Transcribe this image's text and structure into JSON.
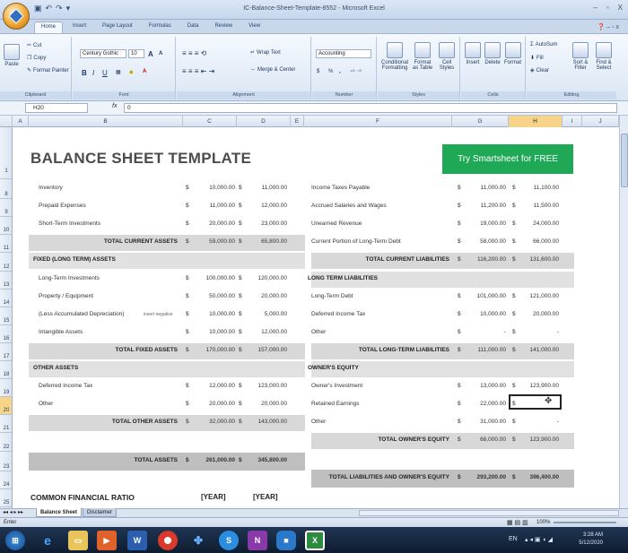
{
  "window": {
    "title": "IC-Balance-Sheet-Template-8552 - Microsoft Excel",
    "min": "–",
    "max": "▫",
    "close": "X"
  },
  "qat": {
    "save": "▣",
    "undo": "↶",
    "redo": "↷",
    "more": "▾"
  },
  "tabs": [
    "Home",
    "Insert",
    "Page Layout",
    "Formulas",
    "Data",
    "Review",
    "View"
  ],
  "ribbon": {
    "clipboard": {
      "paste": "Paste",
      "cut": "Cut",
      "copy": "Copy",
      "painter": "Format Painter",
      "label": "Clipboard"
    },
    "font": {
      "name": "Century Gothic",
      "size": "10",
      "grow": "A",
      "shrink": "A",
      "bold": "B",
      "italic": "I",
      "underline": "U",
      "label": "Font"
    },
    "alignment": {
      "wrap": "Wrap Text",
      "merge": "Merge & Center",
      "label": "Alignment"
    },
    "number": {
      "format": "Accounting",
      "currency": "$",
      "percent": "%",
      "comma": ",",
      "label": "Number"
    },
    "styles": {
      "conditional": "Conditional Formatting",
      "table": "Format as Table",
      "cell": "Cell Styles",
      "label": "Styles"
    },
    "cells": {
      "insert": "Insert",
      "delete": "Delete",
      "format": "Format",
      "label": "Cells"
    },
    "editing": {
      "autosum": "AutoSum",
      "fill": "Fill",
      "clear": "Clear",
      "sort": "Sort & Filter",
      "find": "Find & Select",
      "label": "Editing"
    }
  },
  "formula": {
    "name_box": "H20",
    "fx": "fx",
    "content": "0"
  },
  "columns": [
    "A",
    "B",
    "C",
    "D",
    "E",
    "F",
    "G",
    "H",
    "I",
    "J"
  ],
  "rows": [
    "1",
    "8",
    "9",
    "10",
    "11",
    "12",
    "13",
    "14",
    "15",
    "16",
    "17",
    "18",
    "19",
    "20",
    "21",
    "22",
    "23",
    "24",
    "25"
  ],
  "sheet": {
    "title": "BALANCE SHEET TEMPLATE",
    "cta": "Try Smartsheet for FREE",
    "left": [
      {
        "label": "Inventory",
        "c": "10,000.00",
        "d": "11,000.00"
      },
      {
        "label": "Prepaid Expenses",
        "c": "11,000.00",
        "d": "12,000.00"
      },
      {
        "label": "Short-Term Investments",
        "c": "20,000.00",
        "d": "23,000.00"
      },
      {
        "label": "TOTAL CURRENT ASSETS",
        "c": "59,000.00",
        "d": "65,800.00",
        "total": true
      },
      {
        "label": "FIXED (LONG TERM) ASSETS",
        "section": true
      },
      {
        "label": "Long-Term Investments",
        "c": "100,000.00",
        "d": "120,000.00"
      },
      {
        "label": "Property / Equipment",
        "c": "50,000.00",
        "d": "20,000.00"
      },
      {
        "label": "(Less Accumulated Depreciation)",
        "note": "insert negative",
        "c": "10,000.00",
        "d": "5,000.00"
      },
      {
        "label": "Intangible Assets",
        "c": "10,000.00",
        "d": "12,000.00"
      },
      {
        "label": "TOTAL FIXED ASSETS",
        "c": "170,000.00",
        "d": "157,000.00",
        "total": true
      },
      {
        "label": "OTHER ASSETS",
        "section": true
      },
      {
        "label": "Deferred Income Tax",
        "c": "12,000.00",
        "d": "123,000.00"
      },
      {
        "label": "Other",
        "c": "20,000.00",
        "d": "20,000.00"
      },
      {
        "label": "TOTAL OTHER ASSETS",
        "c": "32,000.00",
        "d": "143,000.00",
        "total": true
      }
    ],
    "right": [
      {
        "label": "Income Taxes Payable",
        "g": "11,000.00",
        "h": "11,100.00"
      },
      {
        "label": "Accrued Salaries and Wages",
        "g": "11,200.00",
        "h": "11,500.00"
      },
      {
        "label": "Unearned Revenue",
        "g": "19,000.00",
        "h": "24,000.00"
      },
      {
        "label": "Current Portion of Long-Term Debt",
        "g": "58,000.00",
        "h": "66,000.00"
      },
      {
        "label": "TOTAL CURRENT LIABILITIES",
        "g": "116,200.00",
        "h": "131,600.00",
        "total": true
      },
      {
        "label": "LONG TERM LIABILITIES",
        "section": true
      },
      {
        "label": "Long-Term Debt",
        "g": "101,000.00",
        "h": "121,000.00"
      },
      {
        "label": "Deferred Income Tax",
        "g": "10,000.00",
        "h": "20,000.00"
      },
      {
        "label": "Other",
        "g": "-",
        "h": "-"
      },
      {
        "label": "TOTAL LONG-TERM LIABILITIES",
        "g": "111,000.00",
        "h": "141,000.00",
        "total": true
      },
      {
        "label": "OWNER'S EQUITY",
        "section": true
      },
      {
        "label": "Owner's Investment",
        "g": "13,000.00",
        "h": "123,900.00"
      },
      {
        "label": "Retained Earnings",
        "g": "22,000.00",
        "h": ""
      },
      {
        "label": "Other",
        "g": "31,000.00",
        "h": "-"
      },
      {
        "label": "TOTAL OWNER'S EQUITY",
        "g": "66,000.00",
        "h": "123,900.00",
        "total": true
      }
    ],
    "total_assets": {
      "label": "TOTAL ASSETS",
      "c": "261,000.00",
      "d": "345,800.00"
    },
    "total_liab": {
      "label": "TOTAL LIABILITIES AND OWNER'S EQUITY",
      "g": "293,200.00",
      "h": "396,400.00"
    },
    "ratio": {
      "label": "COMMON FINANCIAL RATIO",
      "year1": "[YEAR]",
      "year2": "[YEAR]"
    }
  },
  "sheet_tabs": {
    "active": "Balance Sheet",
    "other": "Disclaimer"
  },
  "status": {
    "mode": "Enter",
    "zoom": "100%"
  },
  "taskbar": {
    "lang": "EN",
    "time": "3:28 AM",
    "date": "5/12/2020"
  }
}
